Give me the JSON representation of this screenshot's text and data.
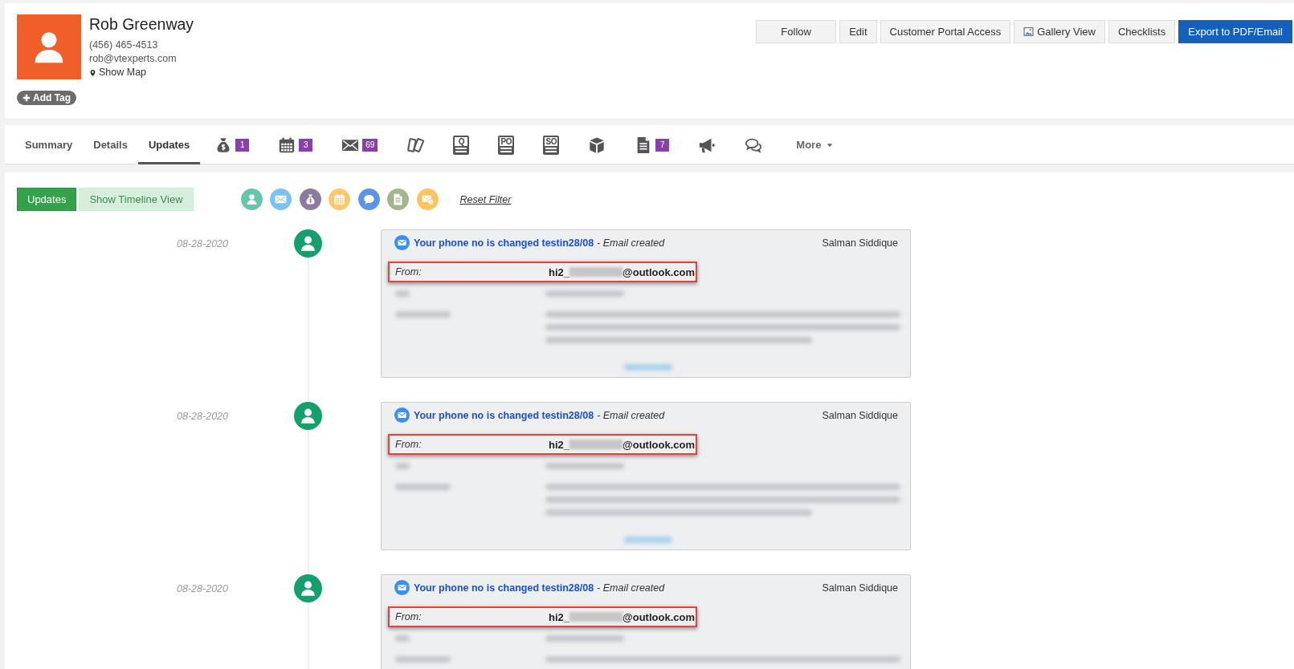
{
  "contact": {
    "name": "Rob Greenway",
    "phone": "(456) 465-4513",
    "email": "rob@vtexperts.com",
    "map_link": "Show Map",
    "add_tag": "Add Tag"
  },
  "actions": [
    {
      "label": "Follow",
      "kind": "default"
    },
    {
      "label": "Edit",
      "kind": "default"
    },
    {
      "label": "Customer Portal Access",
      "kind": "default"
    },
    {
      "label": "Gallery View",
      "kind": "icon"
    },
    {
      "label": "Checklists",
      "kind": "default"
    },
    {
      "label": "Export to PDF/Email",
      "kind": "primary"
    }
  ],
  "tabs": [
    {
      "kind": "text",
      "label": "Summary",
      "selected": false
    },
    {
      "kind": "text",
      "label": "Details",
      "selected": false
    },
    {
      "kind": "text",
      "label": "Updates",
      "selected": true
    },
    {
      "kind": "icon",
      "count": "1",
      "selected": false
    },
    {
      "kind": "icon",
      "count": "3",
      "selected": false
    },
    {
      "kind": "icon",
      "count": "69",
      "selected": false
    },
    {
      "kind": "icon",
      "selected": false
    },
    {
      "kind": "icon",
      "icon_text": "Q",
      "selected": false
    },
    {
      "kind": "icon",
      "icon_text": "PO",
      "selected": false
    },
    {
      "kind": "icon",
      "icon_text": "SO",
      "selected": false
    },
    {
      "kind": "icon",
      "selected": false
    },
    {
      "kind": "icon",
      "count": "7",
      "selected": false
    },
    {
      "kind": "icon",
      "selected": false
    },
    {
      "kind": "icon",
      "selected": false
    },
    {
      "kind": "menu",
      "label": "More",
      "selected": false
    }
  ],
  "view_toggle": [
    {
      "label": "Updates",
      "selected": true
    },
    {
      "label": "Show Timeline View",
      "selected": false
    }
  ],
  "filters": [
    {
      "color": "#63c7aa"
    },
    {
      "color": "#7cc0f8"
    },
    {
      "color": "#8c7b9e"
    },
    {
      "color": "#ffc76a"
    },
    {
      "color": "#5a95e6"
    },
    {
      "color": "#a3b58b"
    },
    {
      "color": "#ffc45e"
    }
  ],
  "reset_filter": "Reset Filter",
  "entries": [
    {
      "date": "08-28-2020",
      "title": "Your phone no is changed testin28/08",
      "action": "- *Email created*",
      "author": "Salman Siddique",
      "from_label": "From:",
      "from_start": "hi2_",
      "from_end": "@outlook.com",
      "highlighted": true
    },
    {
      "date": "08-28-2020",
      "title": "Your phone no is changed testin28/08",
      "action": "- *Email created*",
      "author": "Salman Siddique",
      "from_label": "From:",
      "from_start": "hi2_",
      "from_end": "@outlook.com",
      "highlighted": true
    },
    {
      "date": "08-28-2020",
      "title": "Your phone no is changed testin28/08",
      "action": "- *Email created*",
      "author": "Salman Siddique",
      "from_label": "From:",
      "from_start": "hi2_",
      "from_end": "@outlook.com",
      "highlighted": true
    }
  ]
}
